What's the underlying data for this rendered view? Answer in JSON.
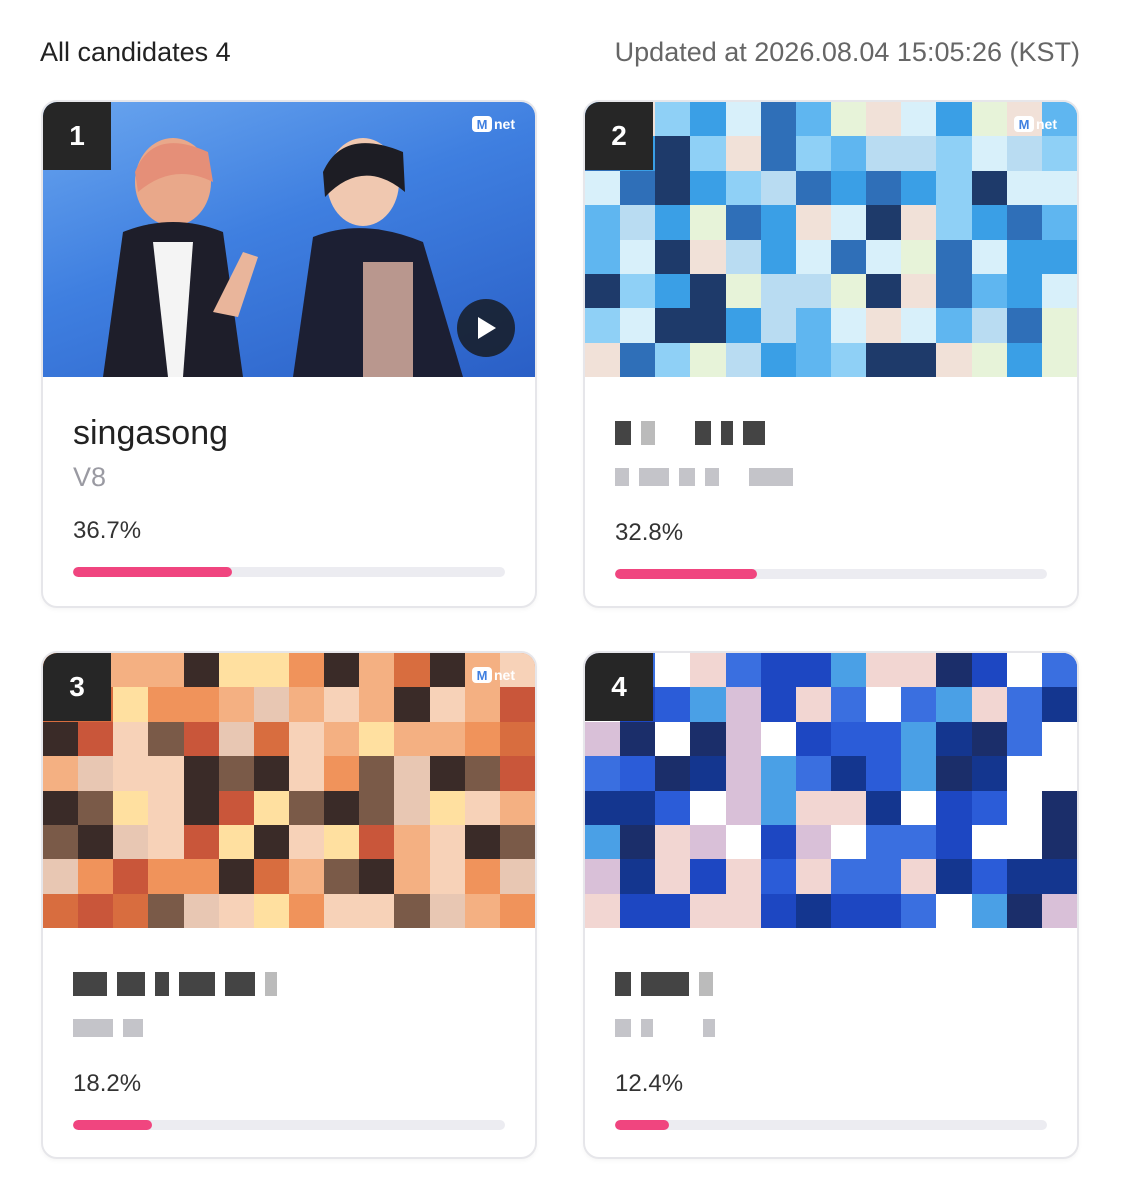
{
  "header": {
    "title": "All candidates 4",
    "updated": "Updated at 2026.08.04 15:05:26 (KST)"
  },
  "brand": {
    "logo_m": "M",
    "logo_text": "net",
    "accent": "#f0457f"
  },
  "candidates": [
    {
      "rank": "1",
      "song": "singasong",
      "artist": "V8",
      "percent_label": "36.7%",
      "percent": 36.7
    },
    {
      "rank": "2",
      "song": "",
      "artist": "",
      "percent_label": "32.8%",
      "percent": 32.8
    },
    {
      "rank": "3",
      "song": "",
      "artist": "",
      "percent_label": "18.2%",
      "percent": 18.2
    },
    {
      "rank": "4",
      "song": "",
      "artist": "",
      "percent_label": "12.4%",
      "percent": 12.4
    }
  ]
}
